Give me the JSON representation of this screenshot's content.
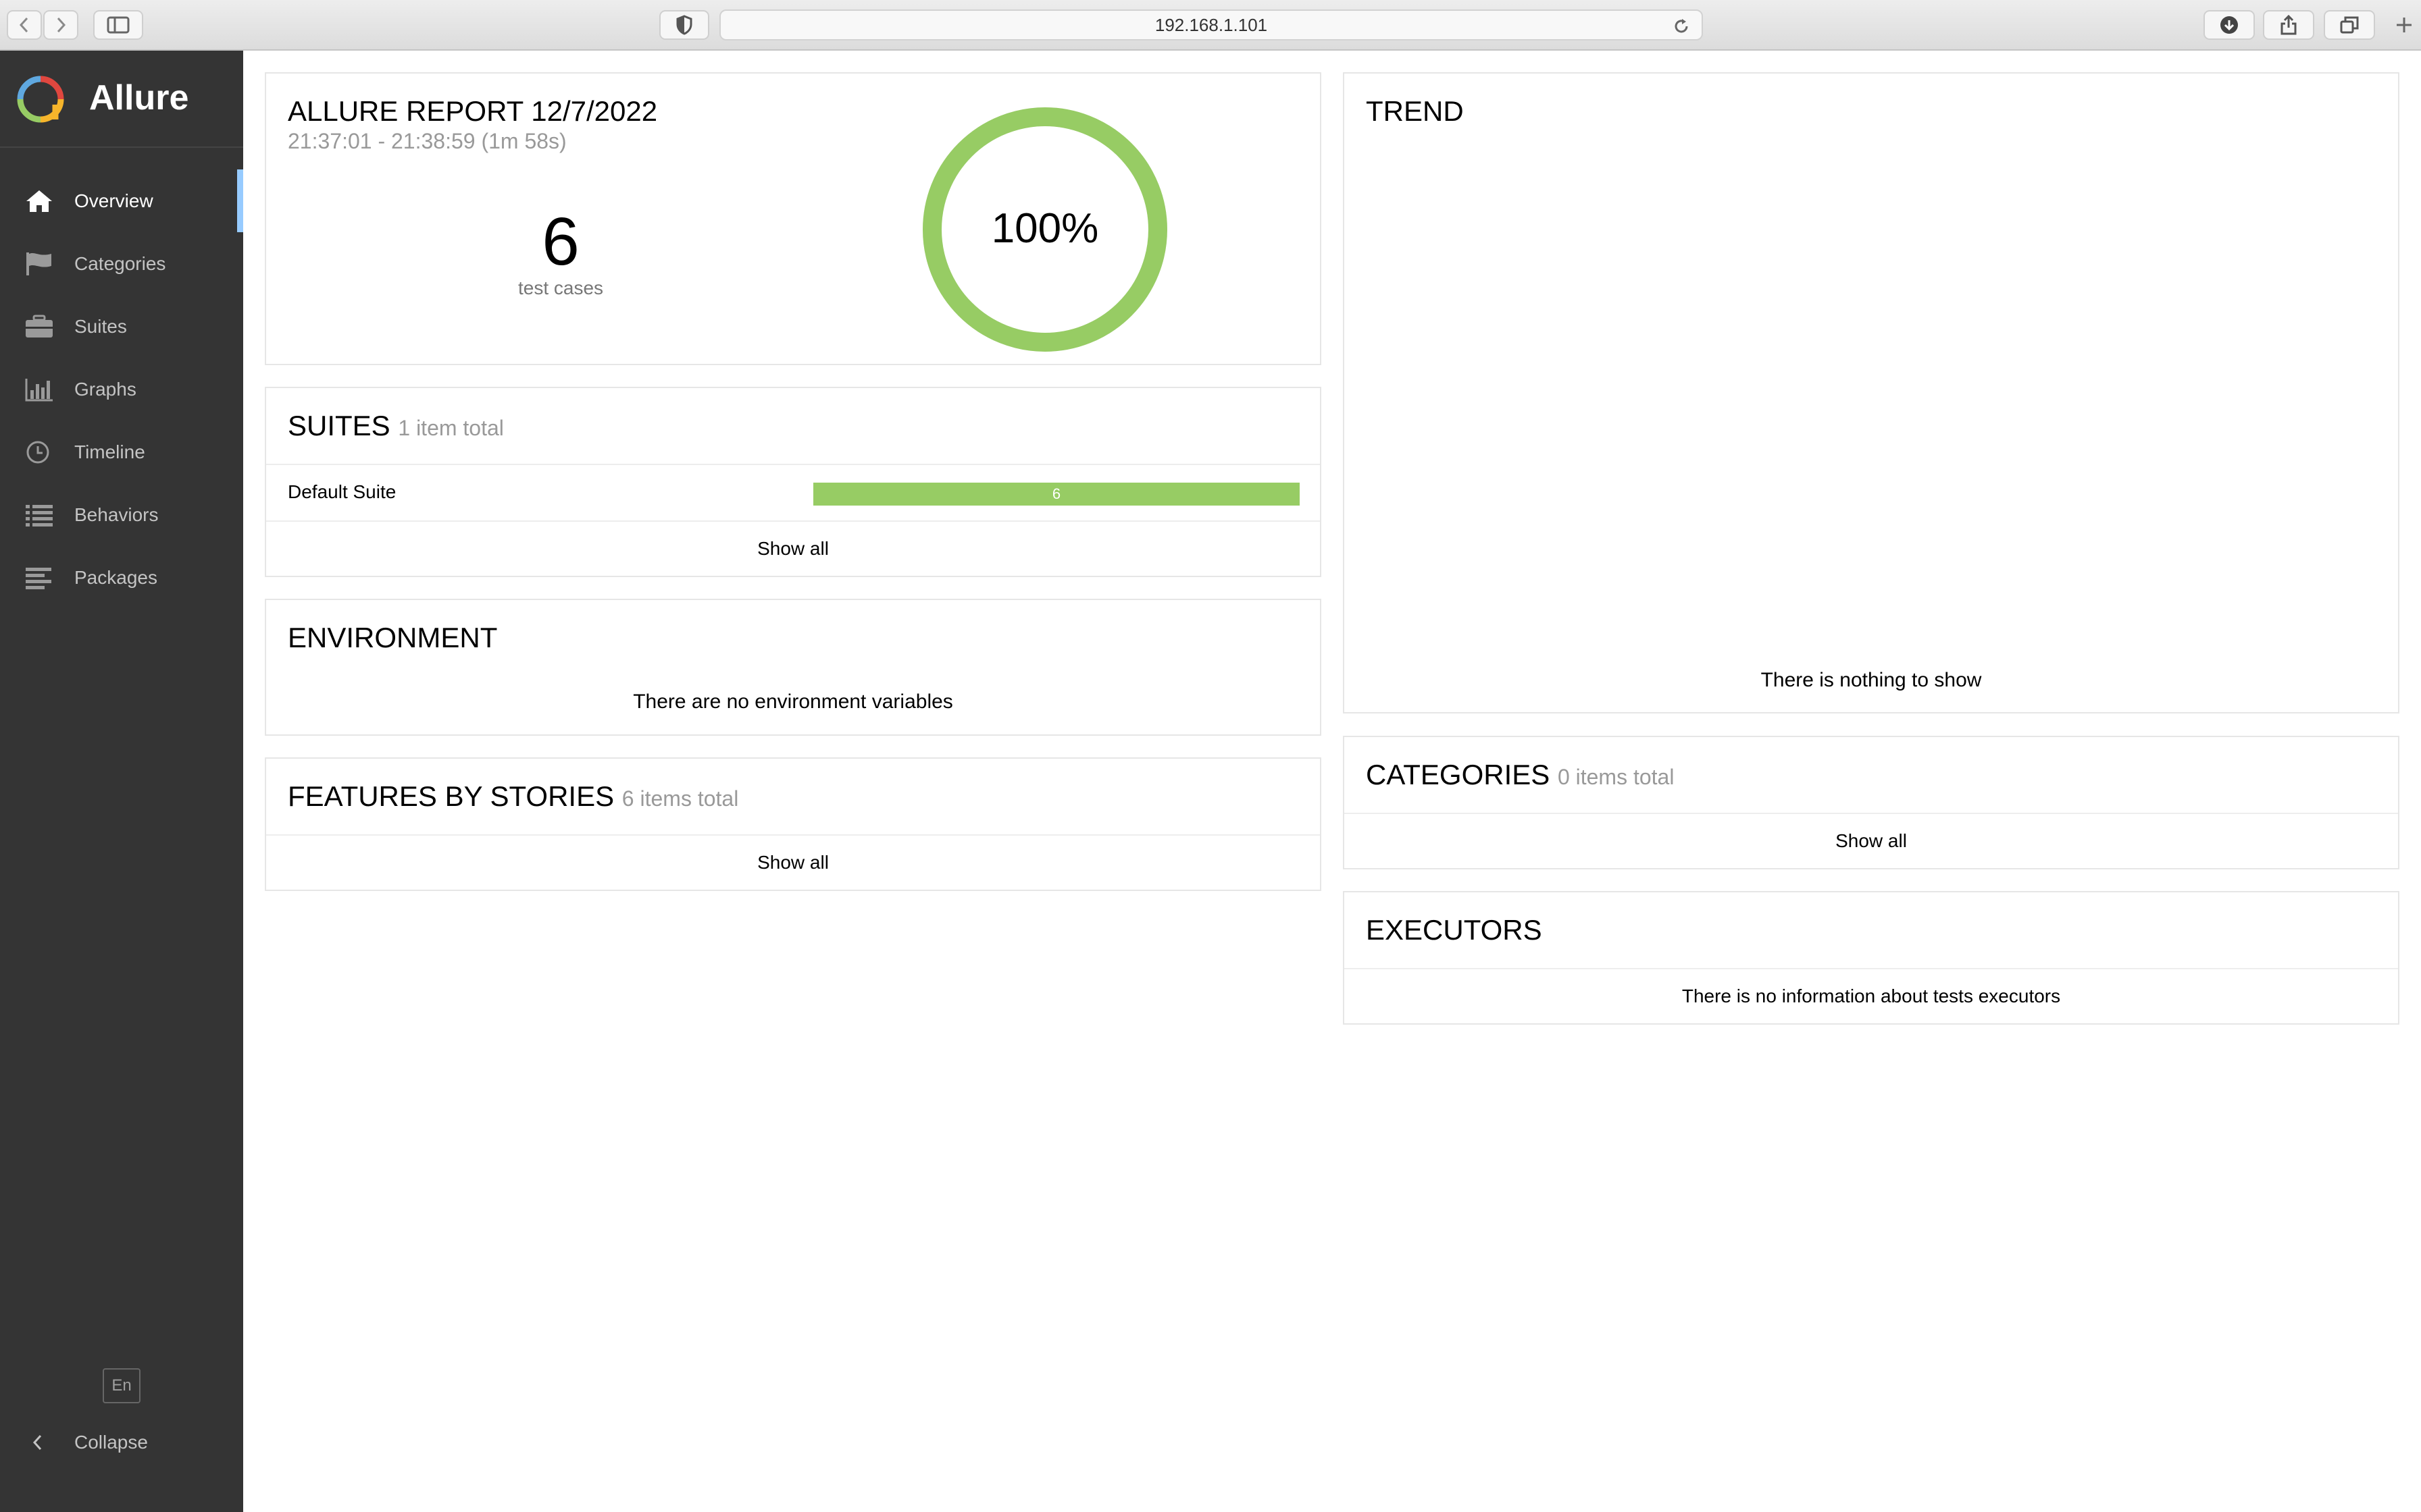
{
  "browser": {
    "url": "192.168.1.101"
  },
  "sidebar": {
    "brand": "Allure",
    "items": [
      {
        "label": "Overview",
        "icon": "home-icon",
        "active": true
      },
      {
        "label": "Categories",
        "icon": "flag-icon",
        "active": false
      },
      {
        "label": "Suites",
        "icon": "briefcase-icon",
        "active": false
      },
      {
        "label": "Graphs",
        "icon": "bar-chart-icon",
        "active": false
      },
      {
        "label": "Timeline",
        "icon": "clock-icon",
        "active": false
      },
      {
        "label": "Behaviors",
        "icon": "list-icon",
        "active": false
      },
      {
        "label": "Packages",
        "icon": "align-left-icon",
        "active": false
      }
    ],
    "language": "En",
    "collapse_label": "Collapse"
  },
  "summary": {
    "title": "ALLURE REPORT 12/7/2022",
    "time_range": "21:37:01 - 21:38:59 (1m 58s)",
    "test_count": "6",
    "test_count_label": "test cases",
    "percent_label": "100%",
    "passed_fraction": 1.0,
    "ring_color": "#97cc64"
  },
  "suites": {
    "title": "SUITES",
    "subtitle": "1 item total",
    "rows": [
      {
        "name": "Default Suite",
        "count": "6",
        "fraction": 1.0
      }
    ],
    "show_all": "Show all"
  },
  "environment": {
    "title": "ENVIRONMENT",
    "empty_message": "There are no environment variables"
  },
  "features": {
    "title": "FEATURES BY STORIES",
    "subtitle": "6 items total",
    "show_all": "Show all"
  },
  "trend": {
    "title": "TREND",
    "empty_message": "There is nothing to show"
  },
  "categories": {
    "title": "CATEGORIES",
    "subtitle": "0 items total",
    "show_all": "Show all"
  },
  "executors": {
    "title": "EXECUTORS",
    "empty_message": "There is no information about tests executors"
  },
  "colors": {
    "passed": "#97cc64",
    "sidebar_bg": "#343434",
    "active_marker": "#97cbff"
  }
}
